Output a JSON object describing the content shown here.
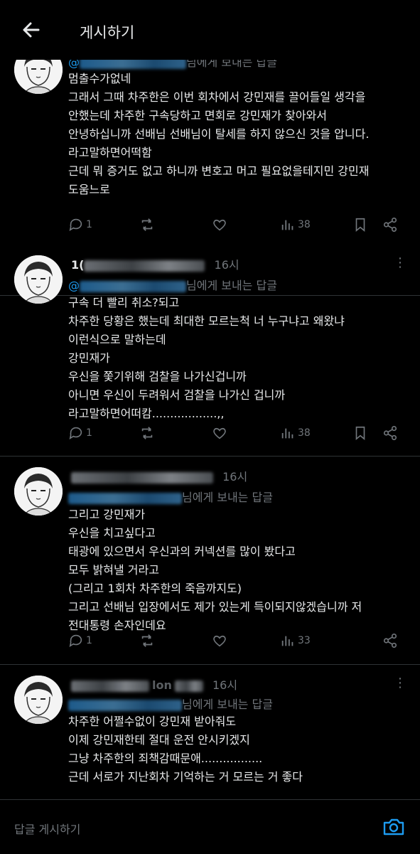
{
  "header": {
    "title": "게시하기",
    "back_icon": "arrow-left-icon"
  },
  "reply_suffix": "님에게 보내는 답글",
  "posts": [
    {
      "lines": [
        "멈출수가없네",
        "그래서 그때 차주한은 이번 회차에서 강민재를 끌어들일 생각을",
        "안했는데 차주한 구속당하고 면회로 강민재가 찾아와서",
        "안녕하십니까 선배님 선배님이 탈세를 하지 않으신 것을 압니다.",
        "라고말하면어떡함",
        "근데 뭐 증거도 없고 하니까 변호고 머고 필요없을테지민 강민재",
        "도움느로"
      ],
      "replies": "1",
      "views": "38"
    },
    {
      "handle_visible": "1(",
      "time": "16시",
      "lines": [
        "구속 더 빨리 취소?되고",
        "차주한 당황은 했는데 최대한 모르는척 너 누구냐고 왜왔냐",
        "이런식으로 말하는데",
        "강민재가",
        "우신을 쫓기위해 검찰을 나가신겁니까",
        "아니면 우신이 두려워서 검찰을 나가신 겁니까",
        "라고말하면어떠캄..................,,"
      ],
      "replies": "1",
      "views": "38"
    },
    {
      "time": "16시",
      "lines": [
        "그리고 강민재가",
        "우신을 치고싶다고",
        "태광에 있으면서 우신과의 커넥션를 많이 봤다고",
        "모두 밝혀낼 거라고",
        "(그리고 1회차 차주한의 죽음까지도)",
        "그리고 선배님 입장에서도 제가 있는게 득이되지않겠습니까 저",
        "전대통령 손자인데요"
      ],
      "replies": "1",
      "views": "33"
    },
    {
      "handle_visible": "lon",
      "time": "16시",
      "lines": [
        "차주한 어쩔수없이 강민재 받아줘도",
        "이제 강민재한테 절대 운전 안시키겠지",
        "그냥 차주한의 죄책감때문애.................",
        "근데 서로가 지난회차 기억하는 거 모르는 거 좋다"
      ]
    }
  ],
  "composer": {
    "placeholder": "답글 게시하기",
    "camera_icon": "camera-icon"
  },
  "colors": {
    "background": "#000000",
    "text": "#e7e9ea",
    "muted": "#71767b",
    "accent": "#1d9bf0"
  }
}
